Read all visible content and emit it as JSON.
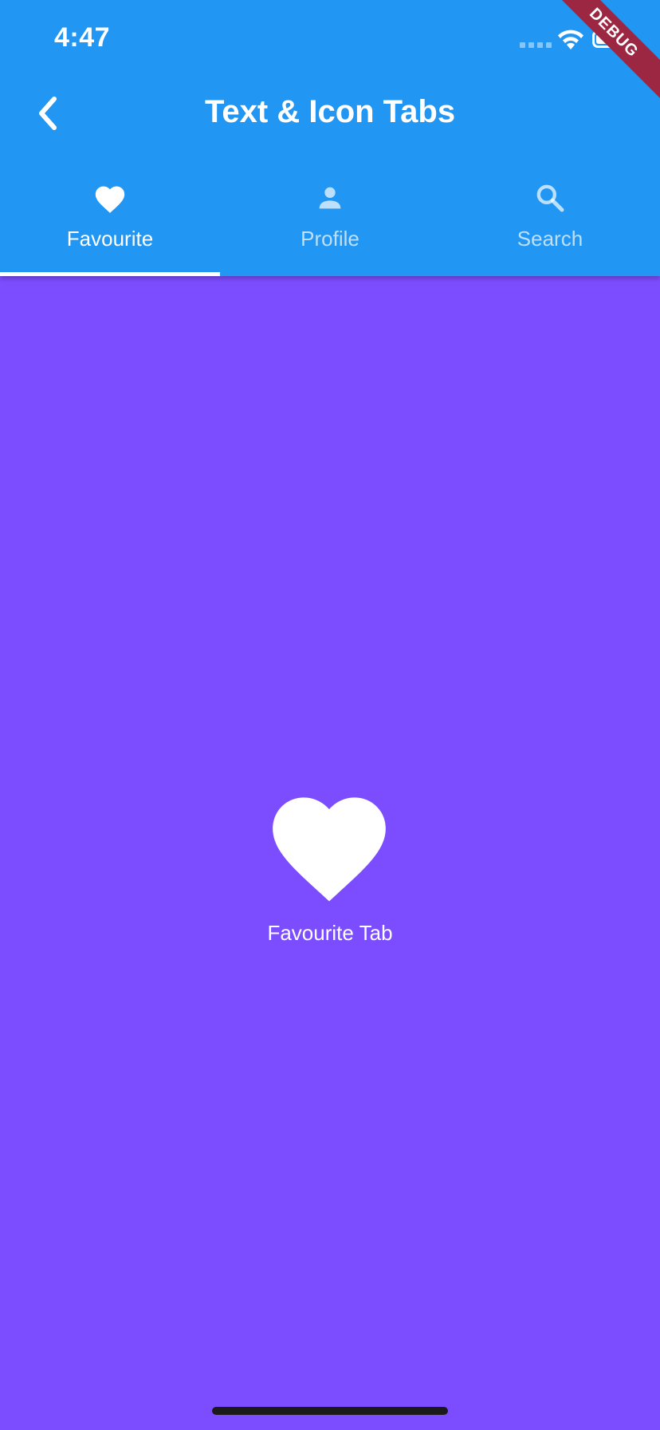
{
  "status_bar": {
    "time": "4:47"
  },
  "app_bar": {
    "title": "Text & Icon Tabs",
    "back_icon": "chevron-left-icon",
    "background_color": "#2196F3"
  },
  "tabs": [
    {
      "label": "Favourite",
      "icon": "heart-icon",
      "selected": true
    },
    {
      "label": "Profile",
      "icon": "person-icon",
      "selected": false
    },
    {
      "label": "Search",
      "icon": "search-icon",
      "selected": false
    }
  ],
  "content": {
    "icon": "heart-icon",
    "label": "Favourite Tab",
    "background_color": "#7C4DFF"
  },
  "debug_banner": {
    "text": "DEBUG"
  }
}
